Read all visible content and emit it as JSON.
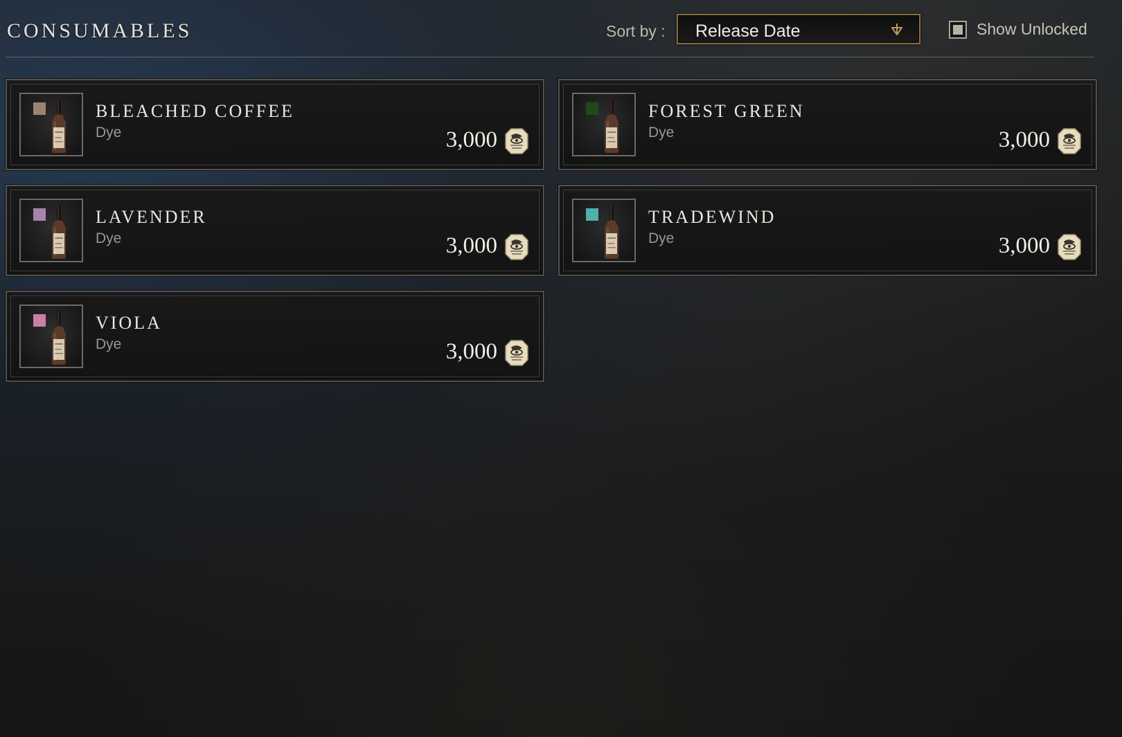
{
  "header": {
    "title": "CONSUMABLES",
    "sort_label": "Sort by :",
    "sort_value": "Release Date",
    "show_unlocked_label": "Show Unlocked"
  },
  "colors": {
    "dropdown_border": "#8a6d3b",
    "text_primary": "#ece8e0",
    "text_secondary": "#9b978f"
  },
  "items": [
    {
      "name": "BLEACHED COFFEE",
      "type": "Dye",
      "price": "3,000",
      "swatch": "#9c8472",
      "currency_icon": "coin-icon"
    },
    {
      "name": "FOREST GREEN",
      "type": "Dye",
      "price": "3,000",
      "swatch": "#1f4a16",
      "currency_icon": "coin-icon"
    },
    {
      "name": "LAVENDER",
      "type": "Dye",
      "price": "3,000",
      "swatch": "#a784ad",
      "currency_icon": "coin-icon"
    },
    {
      "name": "TRADEWIND",
      "type": "Dye",
      "price": "3,000",
      "swatch": "#4fb0ac",
      "currency_icon": "coin-icon"
    },
    {
      "name": "VIOLA",
      "type": "Dye",
      "price": "3,000",
      "swatch": "#c97fa6",
      "currency_icon": "coin-icon"
    }
  ]
}
